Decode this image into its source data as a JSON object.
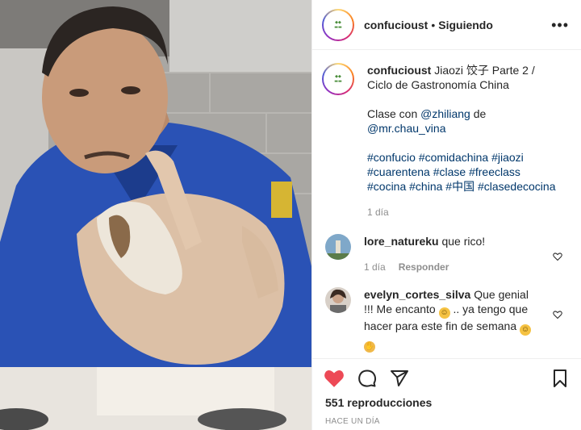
{
  "header": {
    "username": "confucioust",
    "separator": "•",
    "follow_status": "Siguiendo",
    "more_icon": "ellipsis-icon"
  },
  "caption": {
    "username": "confucioust",
    "line1": "Jiaozi 饺子 Parte 2 / Ciclo de Gastronomía China",
    "clase_prefix": "Clase con ",
    "mention1": "@zhiliang",
    "de": " de",
    "mention2": "@mr.chau_vina",
    "hashtags": "#confucio #comidachina #jiaozi #cuarentena #clase #freeclass #cocina #china #中国 #clasedecocina",
    "time": "1 día"
  },
  "comments": [
    {
      "username": "lore_natureku",
      "text": "que rico!",
      "time": "1 día",
      "reply": "Responder"
    },
    {
      "username": "evelyn_cortes_silva",
      "text": "Que genial !!! Me encanto",
      "text2": " .. ya tengo que hacer para este fin de semana",
      "emoji": "grin-emoji"
    }
  ],
  "actions": {
    "views": "551 reproducciones",
    "posted": "HACE UN DÍA",
    "icons": [
      "heart-filled-icon",
      "comment-icon",
      "share-icon",
      "bookmark-icon"
    ],
    "like_color": "#ed4956"
  }
}
